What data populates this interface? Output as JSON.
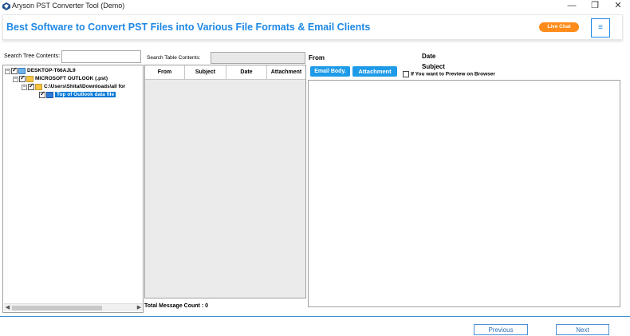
{
  "window": {
    "title": "Aryson PST Converter Tool (Demo)",
    "minimize": "—",
    "restore": "❐",
    "close": "✕"
  },
  "banner": {
    "headline": "Best Software to Convert PST Files into Various File Formats & Email Clients",
    "live_chat": "Live Chat",
    "menu_icon": "≡"
  },
  "tree": {
    "search_label": "Search Tree Contents:",
    "search_value": "",
    "items": [
      {
        "label": "DESKTOP-T66AJL9",
        "icon": "computer-icon",
        "expander": "−"
      },
      {
        "label": "MICROSOFT OUTLOOK (.pst)",
        "icon": "folder-icon",
        "expander": "−"
      },
      {
        "label": "C:\\Users\\Shital\\Downloads\\all for",
        "icon": "folder-icon",
        "expander": "−"
      },
      {
        "label": "Top of Outlook data file",
        "icon": "file-icon",
        "expander": ""
      }
    ],
    "scroll_left": "◀",
    "scroll_right": "▶"
  },
  "table": {
    "search_label": "Search Table Contents:",
    "search_value": "",
    "columns": [
      "From",
      "Subject",
      "Date",
      "Attachment"
    ],
    "rows": [],
    "total_count": "Total Message Count : 0"
  },
  "preview": {
    "from_label": "From",
    "date_label": "Date",
    "subject_label": "Subject",
    "email_body_tab": "Email Body.",
    "attachment_tab": "Attachment",
    "browser_preview": "If You want to Preview on Browser"
  },
  "footer": {
    "previous": "Previous",
    "next": "Next"
  },
  "colors": {
    "accent": "#1e88e5",
    "live_chat": "#ff8c1a",
    "tab": "#1e9be8",
    "selection": "#0078d7"
  }
}
